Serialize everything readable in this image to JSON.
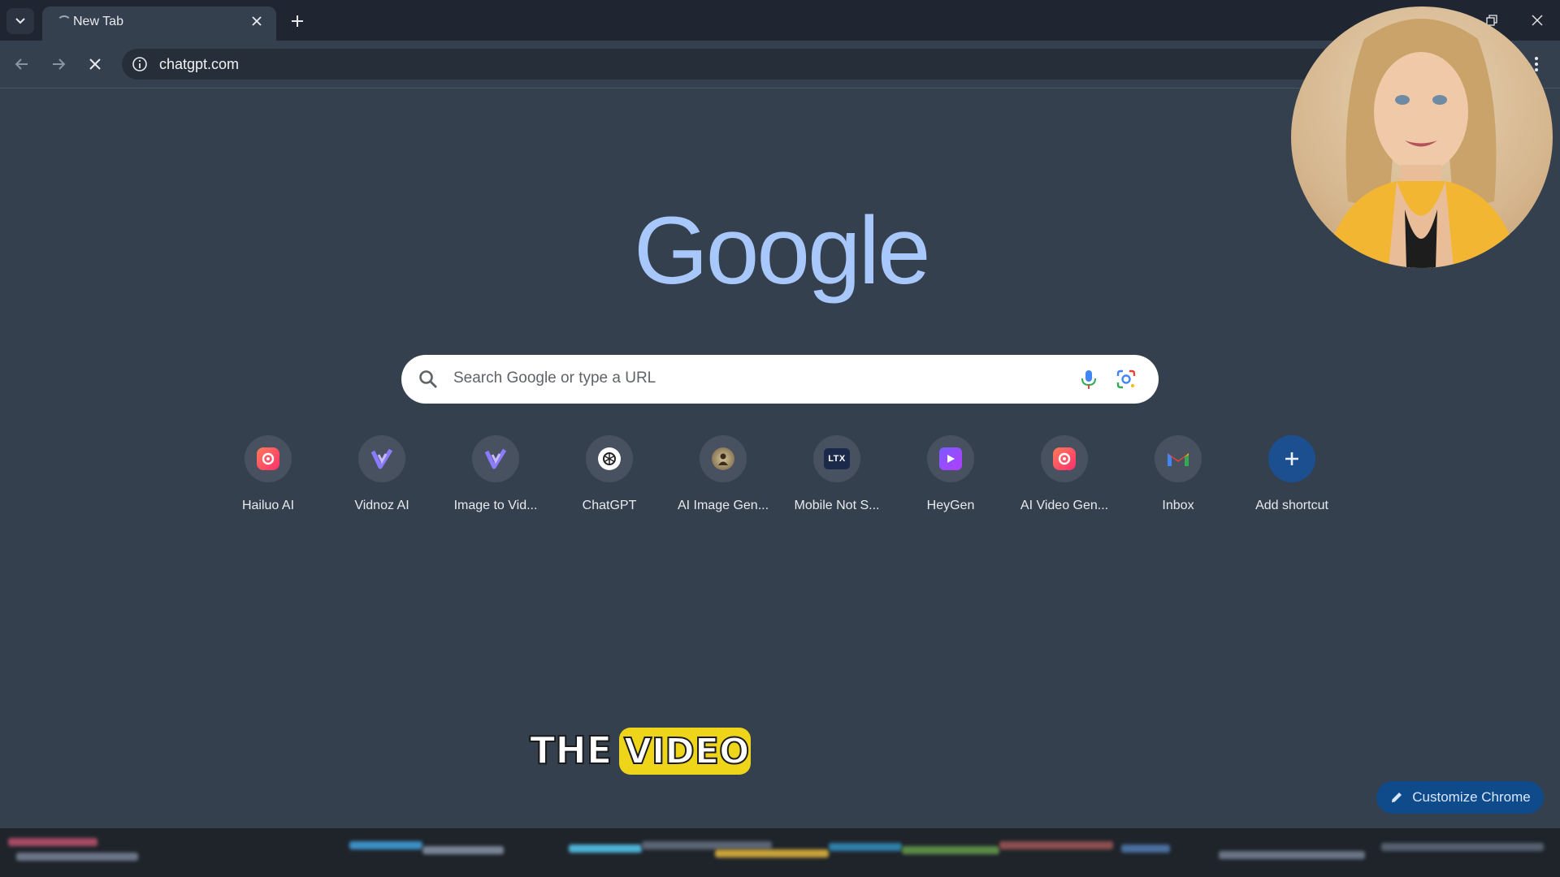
{
  "tab": {
    "title": "New Tab"
  },
  "omnibox": {
    "url": "chatgpt.com"
  },
  "ntp": {
    "logo_text": "Google",
    "search_placeholder": "Search Google or type a URL",
    "shortcuts": [
      {
        "label": "Hailuo AI",
        "icon": "hailuo-icon"
      },
      {
        "label": "Vidnoz AI",
        "icon": "vidnoz-icon"
      },
      {
        "label": "Image to Vid...",
        "icon": "vidnoz-icon"
      },
      {
        "label": "ChatGPT",
        "icon": "openai-icon"
      },
      {
        "label": "AI Image Gen...",
        "icon": "ai-image-gen-icon"
      },
      {
        "label": "Mobile Not S...",
        "icon": "ltx-icon"
      },
      {
        "label": "HeyGen",
        "icon": "heygen-play-icon"
      },
      {
        "label": "AI Video Gen...",
        "icon": "hailuo-icon"
      },
      {
        "label": "Inbox",
        "icon": "gmail-icon"
      },
      {
        "label": "Add shortcut",
        "icon": "plus-icon"
      }
    ],
    "customize_label": "Customize Chrome"
  },
  "overlay": {
    "watermark_part1": "THE",
    "watermark_part2": "VIDEO"
  },
  "colors": {
    "page_bg": "#35404f",
    "logo": "#a8c7fa",
    "accent_button": "#0f4a8a",
    "tile_bg": "#47515f"
  }
}
